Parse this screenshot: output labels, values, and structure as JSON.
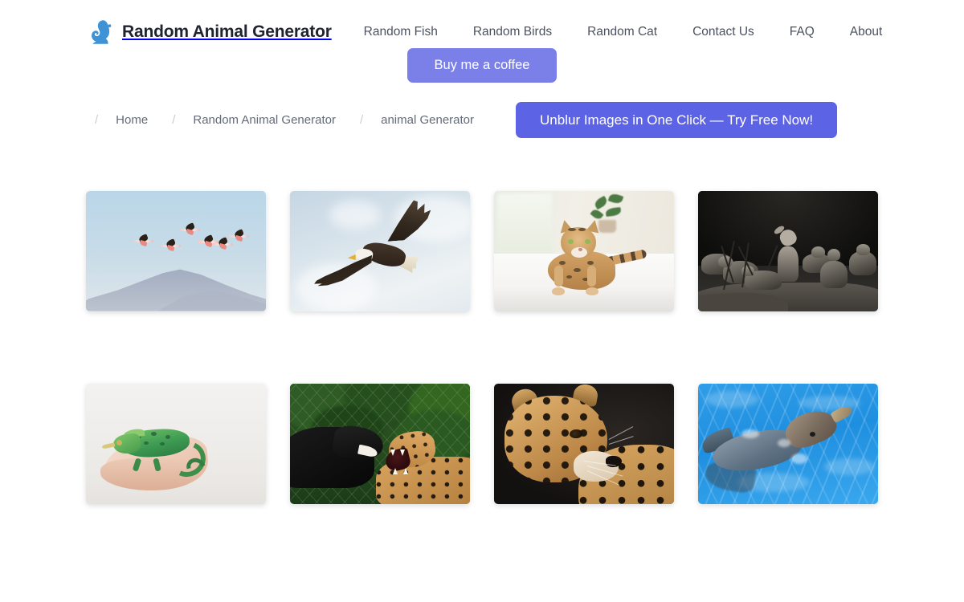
{
  "header": {
    "logo_icon": "squirrel-logo-icon",
    "brand_title": "Random Animal Generator",
    "nav": [
      {
        "label": "Random Fish"
      },
      {
        "label": "Random Birds"
      },
      {
        "label": "Random Cat"
      },
      {
        "label": "Contact Us"
      },
      {
        "label": "FAQ"
      },
      {
        "label": "About"
      }
    ],
    "coffee_button": "Buy me a coffee"
  },
  "breadcrumb": {
    "separator": "/",
    "items": [
      {
        "label": "Home"
      },
      {
        "label": "Random Animal Generator"
      },
      {
        "label": "animal Generator"
      }
    ],
    "cta_button": "Unblur Images in One Click — Try Free Now!"
  },
  "gallery": {
    "images": [
      {
        "alt": "Flock of flamingos flying over a mountain",
        "scene": "flamingo"
      },
      {
        "alt": "Bald eagle soaring in a cloudy sky",
        "scene": "eagle"
      },
      {
        "alt": "Bengal cat lying on a white bed",
        "scene": "cat"
      },
      {
        "alt": "Pack of wolves on rocks at night",
        "scene": "wolves"
      },
      {
        "alt": "Green chameleon resting on a human hand",
        "scene": "chameleon"
      },
      {
        "alt": "Black panther and spotted jaguar snarling by a fence",
        "scene": "panther"
      },
      {
        "alt": "Close-up portrait of a jaguar",
        "scene": "jaguar"
      },
      {
        "alt": "Dolphin swimming in bright blue water",
        "scene": "dolphin"
      }
    ]
  },
  "colors": {
    "coffee_button": "#7b80e8",
    "cta_button": "#5c63e5",
    "brand_text": "#1f2430",
    "nav_text": "#4b5160",
    "logo_blue": "#3e93d6",
    "page_background": "#ffffff"
  }
}
